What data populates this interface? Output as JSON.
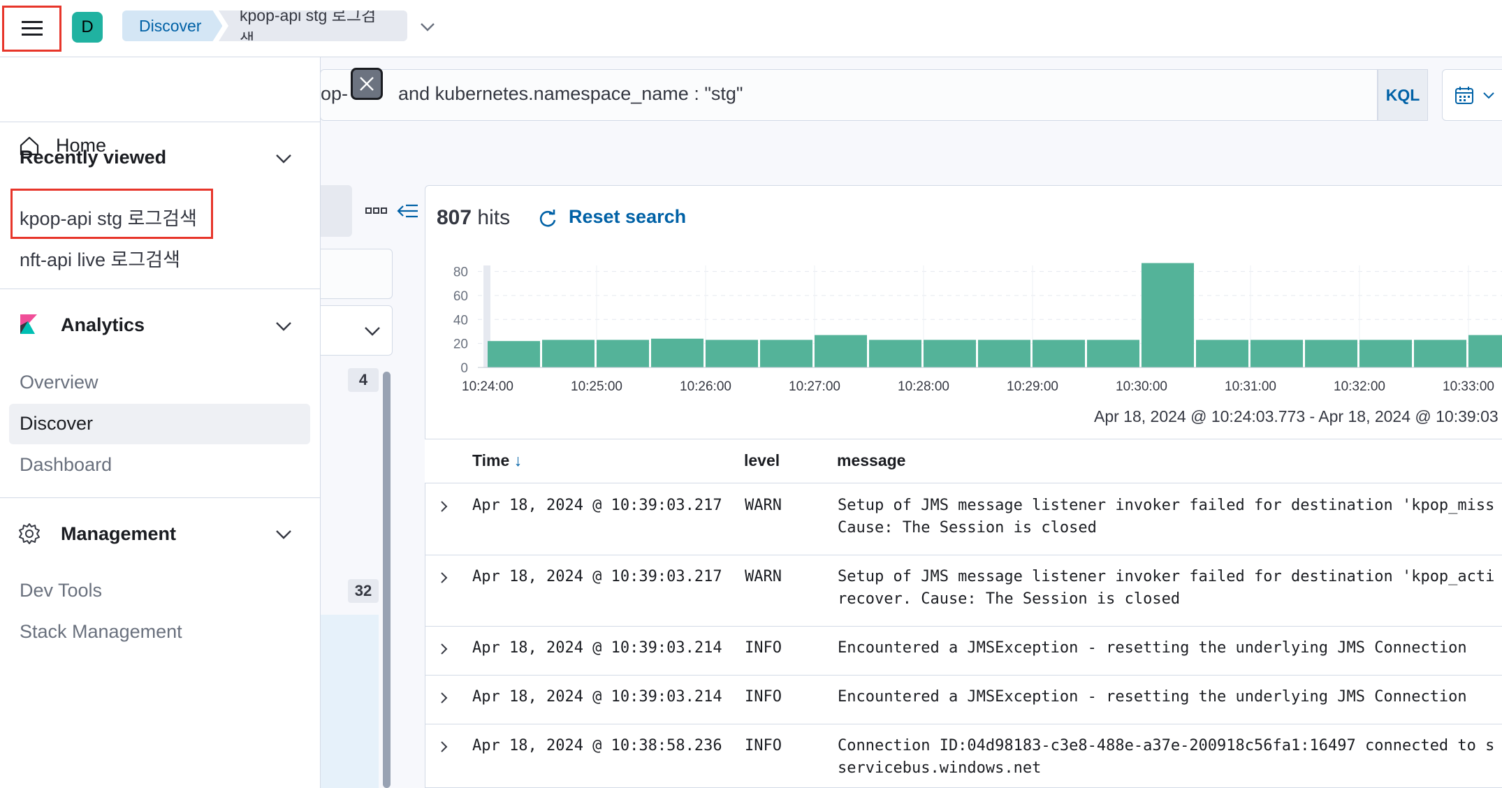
{
  "header": {
    "space_initial": "D",
    "breadcrumbs": [
      "Discover",
      "kpop-api stg 로그검색"
    ]
  },
  "query": {
    "text_prefix": "op-",
    "text": "and kubernetes.namespace_name : \"stg\"",
    "language_button": "KQL"
  },
  "sidebar": {
    "badge_a": "4",
    "badge_b": "32"
  },
  "results": {
    "hits_count": "807",
    "hits_label": "hits",
    "reset_label": "Reset search",
    "time_range": "Apr 18, 2024 @ 10:24:03.773 - Apr 18, 2024 @ 10:39:03"
  },
  "chart_data": {
    "type": "bar",
    "x_ticks": [
      "10:24:00",
      "10:25:00",
      "10:26:00",
      "10:27:00",
      "10:28:00",
      "10:29:00",
      "10:30:00",
      "10:31:00",
      "10:32:00",
      "10:33:00"
    ],
    "y_ticks": [
      "80",
      "60",
      "40",
      "20",
      "0"
    ],
    "ylim": [
      0,
      85
    ],
    "values": [
      22,
      23,
      23,
      24,
      23,
      23,
      27,
      23,
      23,
      23,
      23,
      23,
      87,
      23,
      23,
      23,
      23,
      23,
      27
    ],
    "color": "#54b399"
  },
  "table": {
    "columns": [
      "Time",
      "level",
      "message"
    ],
    "rows": [
      {
        "time": "Apr 18, 2024 @ 10:39:03.217",
        "level": "WARN",
        "message_lines": [
          "Setup of JMS message listener invoker failed for destination 'kpop_miss",
          "Cause: The Session is closed"
        ]
      },
      {
        "time": "Apr 18, 2024 @ 10:39:03.217",
        "level": "WARN",
        "message_lines": [
          "Setup of JMS message listener invoker failed for destination 'kpop_acti",
          "recover. Cause: The Session is closed"
        ]
      },
      {
        "time": "Apr 18, 2024 @ 10:39:03.214",
        "level": "INFO",
        "message_lines": [
          "Encountered a JMSException - resetting the underlying JMS Connection"
        ]
      },
      {
        "time": "Apr 18, 2024 @ 10:39:03.214",
        "level": "INFO",
        "message_lines": [
          "Encountered a JMSException - resetting the underlying JMS Connection"
        ]
      },
      {
        "time": "Apr 18, 2024 @ 10:38:58.236",
        "level": "INFO",
        "message_lines": [
          "Connection ID:04d98183-c3e8-488e-a37e-200918c56fa1:16497 connected to s",
          "servicebus.windows.net"
        ]
      }
    ]
  },
  "nav": {
    "home": "Home",
    "recently_viewed": {
      "title": "Recently viewed",
      "items": [
        "kpop-api stg 로그검색",
        "nft-api live 로그검색"
      ]
    },
    "analytics": {
      "title": "Analytics",
      "items": [
        "Overview",
        "Discover",
        "Dashboard"
      ]
    },
    "management": {
      "title": "Management",
      "items": [
        "Dev Tools",
        "Stack Management"
      ]
    }
  },
  "colors": {
    "accent": "#0061a6",
    "highlight_border": "#e7352a",
    "bar": "#54b399",
    "space_avatar": "#20b2a1"
  }
}
